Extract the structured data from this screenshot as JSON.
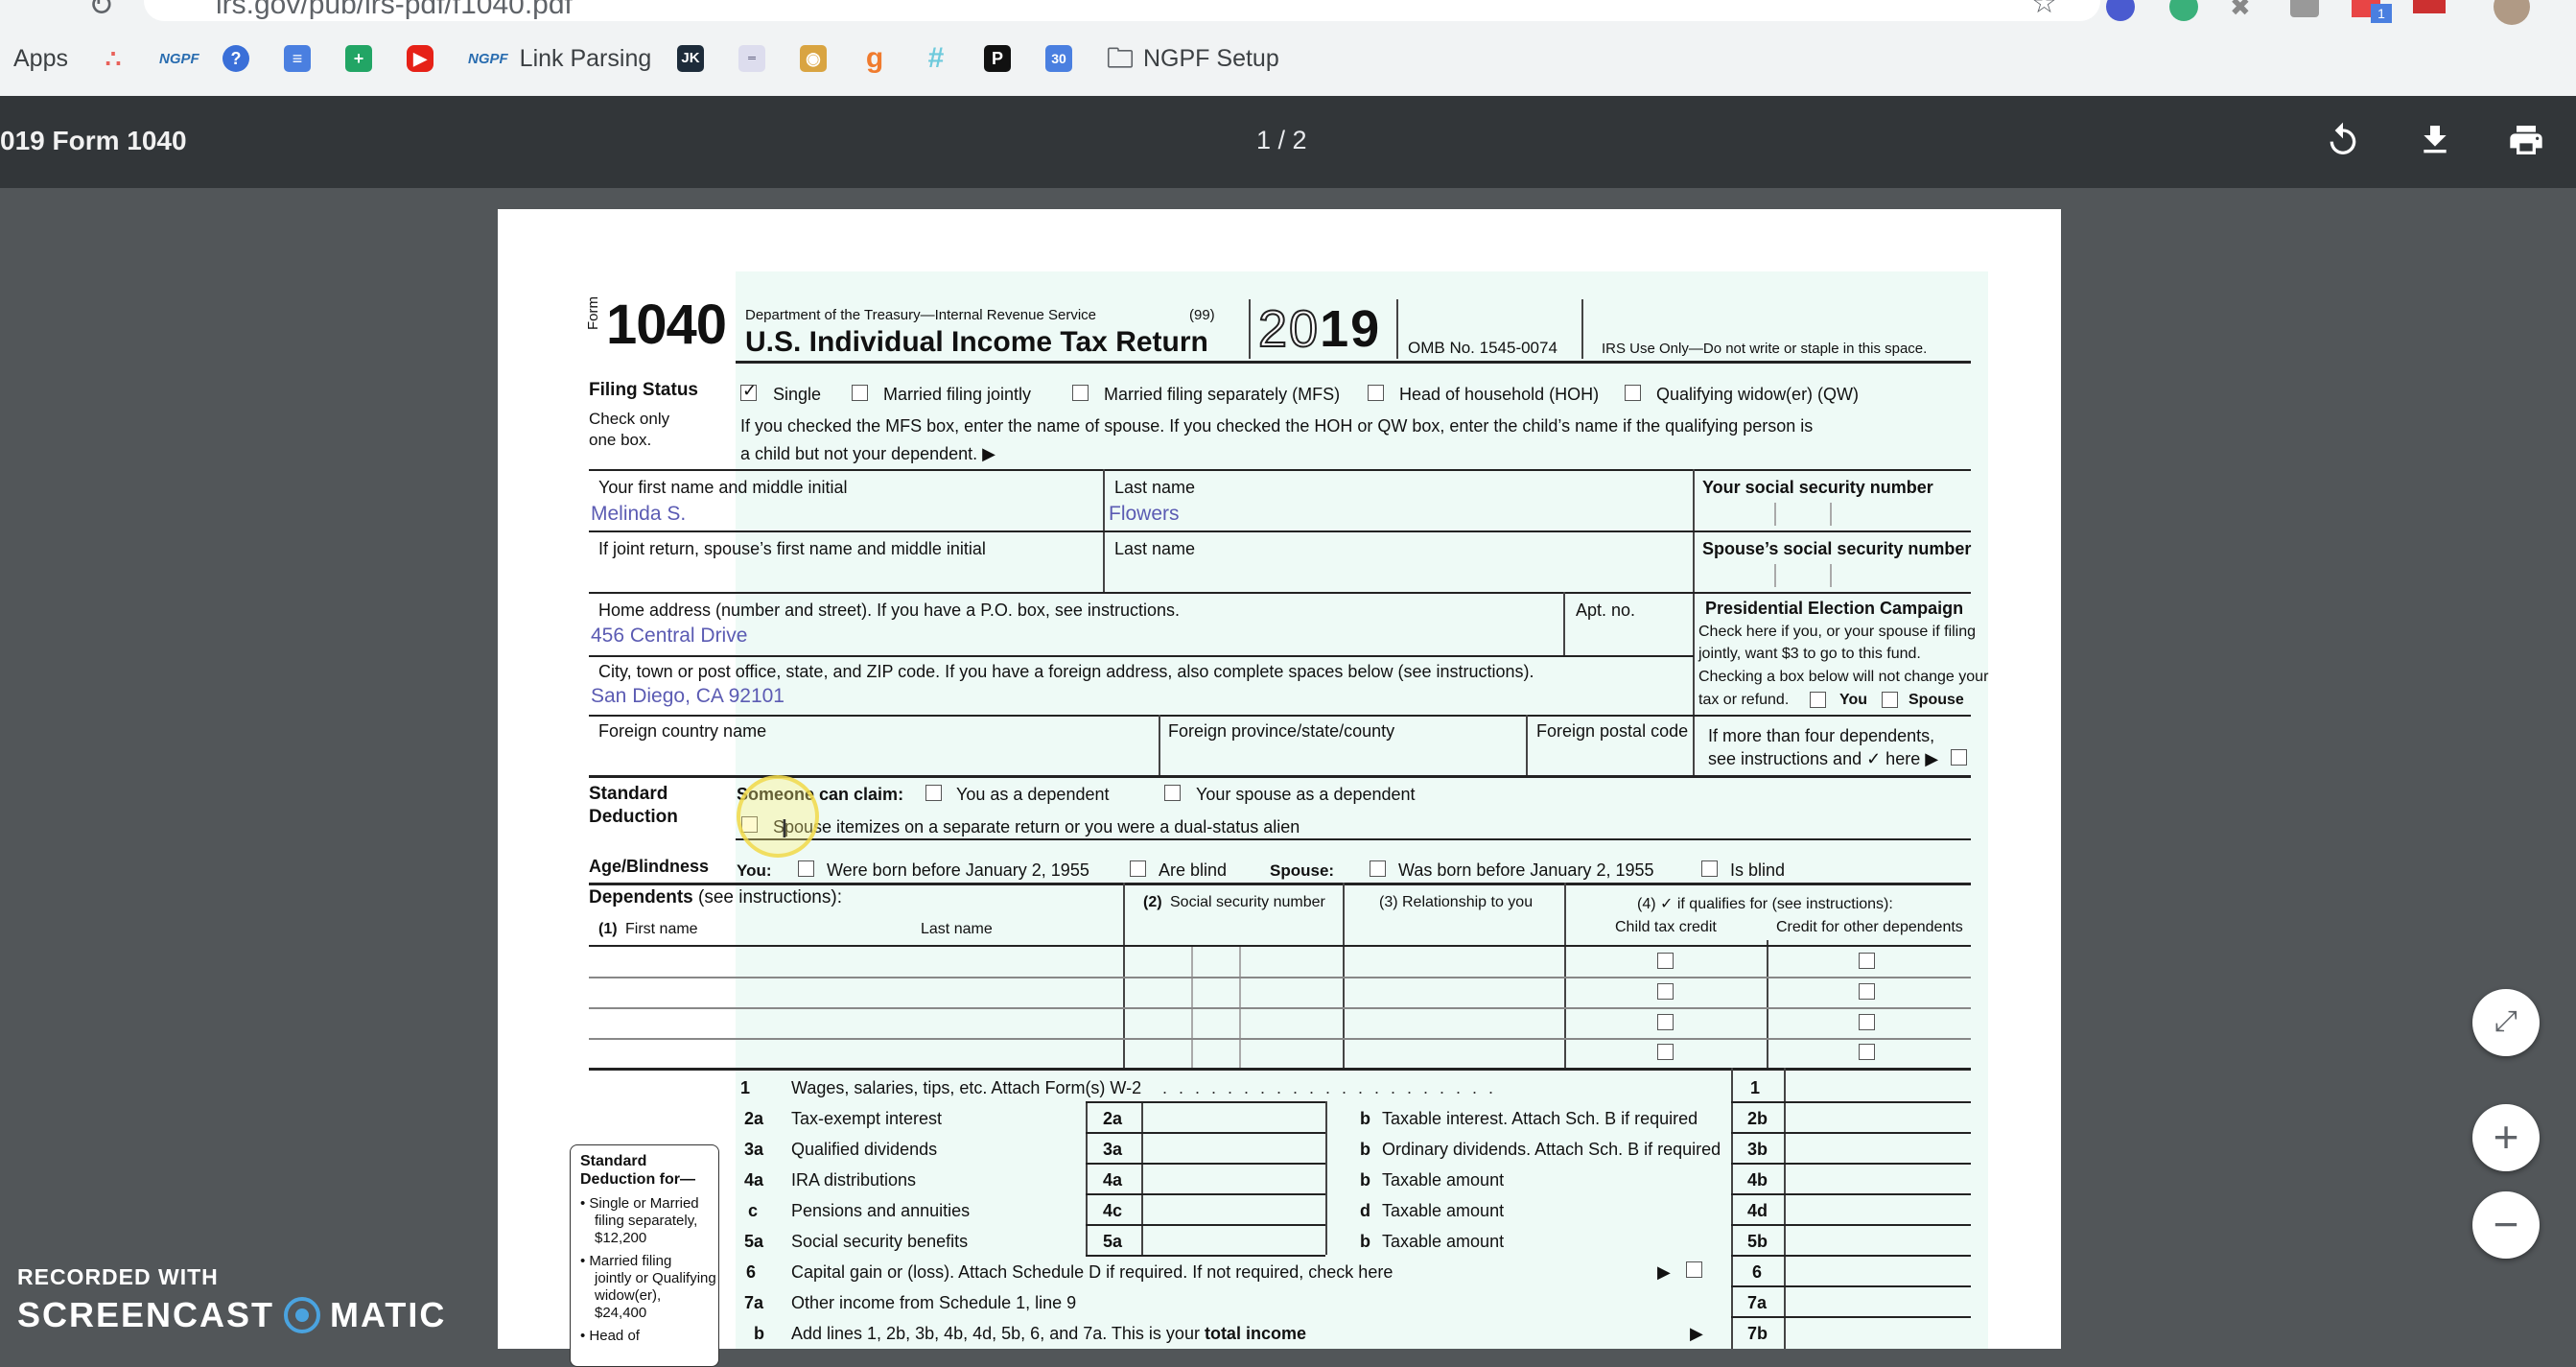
{
  "browser": {
    "url": "irs.gov/pub/irs-pdf/f1040.pdf",
    "bookmarks": {
      "apps": "Apps",
      "ngpf1": "NGPF",
      "link_parsing_prefix": "NGPF",
      "link_parsing": "Link Parsing",
      "jk": "JK",
      "p": "P",
      "cal": "30",
      "ngpf_setup": "NGPF Setup"
    }
  },
  "pdf_toolbar": {
    "title": "019 Form 1040",
    "page_indicator": "1 / 2",
    "icons": [
      "rotate-icon",
      "download-icon",
      "print-icon"
    ]
  },
  "form": {
    "form_label": "Form",
    "form_number": "1040",
    "dept": "Department of the Treasury—Internal Revenue Service",
    "code": "(99)",
    "title": "U.S. Individual Income Tax Return",
    "year_a": "20",
    "year_b": "19",
    "omb": "OMB No. 1545-0074",
    "irs_use": "IRS Use Only—Do not write or staple in this space.",
    "filing_status": {
      "label": "Filing Status",
      "sub1": "Check only",
      "sub2": "one box.",
      "options": [
        "Single",
        "Married filing jointly",
        "Married filing separately (MFS)",
        "Head of household (HOH)",
        "Qualifying widow(er) (QW)"
      ],
      "checked": "Single",
      "note1": "If you checked the MFS box, enter the name of spouse. If you checked the HOH or QW box, enter the child’s name if the qualifying person is",
      "note2": "a child but not your dependent. ▶"
    },
    "name": {
      "first_label": "Your first name and middle initial",
      "first_value": "Melinda S.",
      "last_label": "Last name",
      "last_value": "Flowers",
      "ssn_label": "Your social security number",
      "spouse_first_label": "If joint return, spouse’s first name and middle initial",
      "spouse_last_label": "Last name",
      "spouse_ssn_label": "Spouse’s social security number"
    },
    "address": {
      "home_label": "Home address (number and street). If you have a P.O. box, see instructions.",
      "home_value": "456 Central Drive",
      "apt_label": "Apt. no.",
      "city_label": "City, town or post office, state, and ZIP code. If you have a foreign address, also complete spaces below (see instructions).",
      "city_value": "San Diego, CA 92101",
      "foreign_country": "Foreign country name",
      "foreign_province": "Foreign province/state/county",
      "foreign_postal": "Foreign postal code"
    },
    "pec": {
      "title": "Presidential Election Campaign",
      "l1": "Check here if you, or your spouse if filing",
      "l2": "jointly, want $3 to go to this fund.",
      "l3": "Checking a box below will not change your",
      "l4": "tax or refund.",
      "you": "You",
      "spouse": "Spouse"
    },
    "dependents_more": {
      "l1": "If more than four dependents,",
      "l2": "see instructions and ✓ here ▶"
    },
    "standard_deduction": {
      "label1": "Standard",
      "label2": "Deduction",
      "someone": "Someone can claim:",
      "you_dep": "You as a dependent",
      "spouse_dep": "Your spouse as a dependent",
      "spouse_itemizes": "Spouse itemizes on a separate return or you were a dual-status alien"
    },
    "age_blindness": {
      "label": "Age/Blindness",
      "you": "You:",
      "born": "Were born before January 2, 1955",
      "blind": "Are blind",
      "spouse": "Spouse:",
      "spouse_born": "Was born before January 2, 1955",
      "spouse_blind": "Is blind"
    },
    "dependents": {
      "title": "Dependents",
      "see": "(see instructions):",
      "col1_num": "(1)",
      "col1": "First name",
      "col1b": "Last name",
      "col2_num": "(2)",
      "col2": "Social security number",
      "col3": "(3) Relationship to you",
      "col4_num": "(4) ✓ if qualifies for (see instructions):",
      "col4a": "Child tax credit",
      "col4b": "Credit for other dependents"
    },
    "sd_box": {
      "title1": "Standard",
      "title2": "Deduction for—",
      "i1a": "• Single or Married",
      "i1b": "filing separately,",
      "i1c": "$12,200",
      "i2a": "• Married filing",
      "i2b": "jointly or Qualifying",
      "i2c": "widow(er),",
      "i2d": "$24,400",
      "i3a": "• Head of"
    },
    "lines": {
      "l1_num": "1",
      "l1": "Wages, salaries, tips, etc. Attach Form(s) W-2",
      "l2a_num": "2a",
      "l2a": "Tax-exempt interest",
      "l2b_letter": "b",
      "l2b": "Taxable interest. Attach Sch. B if required",
      "l2b_num": "2b",
      "l3a_num": "3a",
      "l3a": "Qualified dividends",
      "l3b_letter": "b",
      "l3b": "Ordinary dividends. Attach Sch. B if required",
      "l3b_num": "3b",
      "l4a_num": "4a",
      "l4a": "IRA distributions",
      "l4b_letter": "b",
      "l4b": "Taxable amount",
      "l4b_num": "4b",
      "l4c_letter": "c",
      "l4c": "Pensions and annuities",
      "l4c_num": "4c",
      "l4d_letter": "d",
      "l4d": "Taxable amount",
      "l4d_num": "4d",
      "l5a_num": "5a",
      "l5a": "Social security benefits",
      "l5b_letter": "b",
      "l5b": "Taxable amount",
      "l5b_num": "5b",
      "l6_num": "6",
      "l6": "Capital gain or (loss). Attach Schedule D if required. If not required, check here",
      "l7a_num": "7a",
      "l7a": "Other income from Schedule 1, line 9",
      "l7b_letter": "b",
      "l7b": "Add lines 1, 2b, 3b, 4b, 4d, 5b, 6, and 7a. This is your ",
      "l7b_bold": "total income",
      "l7b_num": "7b"
    }
  },
  "watermark": {
    "line1": "RECORDED WITH",
    "line2a": "SCREENCAST",
    "line2b": "MATIC"
  }
}
